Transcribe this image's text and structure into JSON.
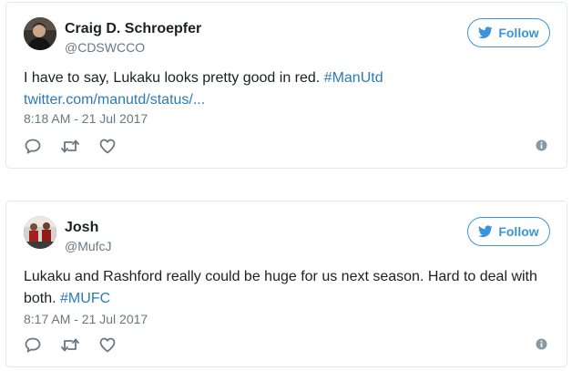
{
  "tweets": [
    {
      "name": "Craig D. Schroepfer",
      "handle": "@CDSWCCO",
      "text_plain": "I have to say, Lukaku looks pretty good in red. ",
      "hashtag": "#ManUtd",
      "link": "twitter.com/manutd/status/...",
      "timestamp": "8:18 AM - 21 Jul 2017",
      "follow_label": "Follow",
      "avatar_icon": "avatar-photo"
    },
    {
      "name": "Josh",
      "handle": "@MufcJ",
      "text_plain": "Lukaku and Rashford really could be huge for us next season. Hard to deal with both. ",
      "hashtag": "#MUFC",
      "timestamp": "8:17 AM - 21 Jul 2017",
      "follow_label": "Follow",
      "avatar_icon": "avatar-photo"
    }
  ],
  "icons": {
    "reply": "reply-icon",
    "retweet": "retweet-icon",
    "like": "heart-icon",
    "info": "info-icon",
    "follow": "twitter-bird-icon"
  },
  "colors": {
    "accent": "#3b94d9",
    "link": "#2b7bb9",
    "muted": "#697882",
    "border": "#e1e8ed"
  }
}
